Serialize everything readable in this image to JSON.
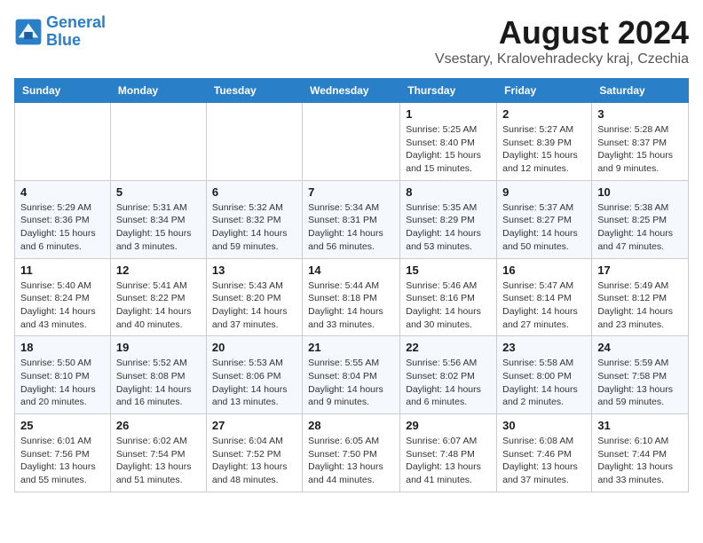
{
  "header": {
    "logo_line1": "General",
    "logo_line2": "Blue",
    "month_title": "August 2024",
    "location": "Vsestary, Kralovehradecky kraj, Czechia"
  },
  "days_of_week": [
    "Sunday",
    "Monday",
    "Tuesday",
    "Wednesday",
    "Thursday",
    "Friday",
    "Saturday"
  ],
  "weeks": [
    [
      {
        "day": "",
        "info": ""
      },
      {
        "day": "",
        "info": ""
      },
      {
        "day": "",
        "info": ""
      },
      {
        "day": "",
        "info": ""
      },
      {
        "day": "1",
        "info": "Sunrise: 5:25 AM\nSunset: 8:40 PM\nDaylight: 15 hours\nand 15 minutes."
      },
      {
        "day": "2",
        "info": "Sunrise: 5:27 AM\nSunset: 8:39 PM\nDaylight: 15 hours\nand 12 minutes."
      },
      {
        "day": "3",
        "info": "Sunrise: 5:28 AM\nSunset: 8:37 PM\nDaylight: 15 hours\nand 9 minutes."
      }
    ],
    [
      {
        "day": "4",
        "info": "Sunrise: 5:29 AM\nSunset: 8:36 PM\nDaylight: 15 hours\nand 6 minutes."
      },
      {
        "day": "5",
        "info": "Sunrise: 5:31 AM\nSunset: 8:34 PM\nDaylight: 15 hours\nand 3 minutes."
      },
      {
        "day": "6",
        "info": "Sunrise: 5:32 AM\nSunset: 8:32 PM\nDaylight: 14 hours\nand 59 minutes."
      },
      {
        "day": "7",
        "info": "Sunrise: 5:34 AM\nSunset: 8:31 PM\nDaylight: 14 hours\nand 56 minutes."
      },
      {
        "day": "8",
        "info": "Sunrise: 5:35 AM\nSunset: 8:29 PM\nDaylight: 14 hours\nand 53 minutes."
      },
      {
        "day": "9",
        "info": "Sunrise: 5:37 AM\nSunset: 8:27 PM\nDaylight: 14 hours\nand 50 minutes."
      },
      {
        "day": "10",
        "info": "Sunrise: 5:38 AM\nSunset: 8:25 PM\nDaylight: 14 hours\nand 47 minutes."
      }
    ],
    [
      {
        "day": "11",
        "info": "Sunrise: 5:40 AM\nSunset: 8:24 PM\nDaylight: 14 hours\nand 43 minutes."
      },
      {
        "day": "12",
        "info": "Sunrise: 5:41 AM\nSunset: 8:22 PM\nDaylight: 14 hours\nand 40 minutes."
      },
      {
        "day": "13",
        "info": "Sunrise: 5:43 AM\nSunset: 8:20 PM\nDaylight: 14 hours\nand 37 minutes."
      },
      {
        "day": "14",
        "info": "Sunrise: 5:44 AM\nSunset: 8:18 PM\nDaylight: 14 hours\nand 33 minutes."
      },
      {
        "day": "15",
        "info": "Sunrise: 5:46 AM\nSunset: 8:16 PM\nDaylight: 14 hours\nand 30 minutes."
      },
      {
        "day": "16",
        "info": "Sunrise: 5:47 AM\nSunset: 8:14 PM\nDaylight: 14 hours\nand 27 minutes."
      },
      {
        "day": "17",
        "info": "Sunrise: 5:49 AM\nSunset: 8:12 PM\nDaylight: 14 hours\nand 23 minutes."
      }
    ],
    [
      {
        "day": "18",
        "info": "Sunrise: 5:50 AM\nSunset: 8:10 PM\nDaylight: 14 hours\nand 20 minutes."
      },
      {
        "day": "19",
        "info": "Sunrise: 5:52 AM\nSunset: 8:08 PM\nDaylight: 14 hours\nand 16 minutes."
      },
      {
        "day": "20",
        "info": "Sunrise: 5:53 AM\nSunset: 8:06 PM\nDaylight: 14 hours\nand 13 minutes."
      },
      {
        "day": "21",
        "info": "Sunrise: 5:55 AM\nSunset: 8:04 PM\nDaylight: 14 hours\nand 9 minutes."
      },
      {
        "day": "22",
        "info": "Sunrise: 5:56 AM\nSunset: 8:02 PM\nDaylight: 14 hours\nand 6 minutes."
      },
      {
        "day": "23",
        "info": "Sunrise: 5:58 AM\nSunset: 8:00 PM\nDaylight: 14 hours\nand 2 minutes."
      },
      {
        "day": "24",
        "info": "Sunrise: 5:59 AM\nSunset: 7:58 PM\nDaylight: 13 hours\nand 59 minutes."
      }
    ],
    [
      {
        "day": "25",
        "info": "Sunrise: 6:01 AM\nSunset: 7:56 PM\nDaylight: 13 hours\nand 55 minutes."
      },
      {
        "day": "26",
        "info": "Sunrise: 6:02 AM\nSunset: 7:54 PM\nDaylight: 13 hours\nand 51 minutes."
      },
      {
        "day": "27",
        "info": "Sunrise: 6:04 AM\nSunset: 7:52 PM\nDaylight: 13 hours\nand 48 minutes."
      },
      {
        "day": "28",
        "info": "Sunrise: 6:05 AM\nSunset: 7:50 PM\nDaylight: 13 hours\nand 44 minutes."
      },
      {
        "day": "29",
        "info": "Sunrise: 6:07 AM\nSunset: 7:48 PM\nDaylight: 13 hours\nand 41 minutes."
      },
      {
        "day": "30",
        "info": "Sunrise: 6:08 AM\nSunset: 7:46 PM\nDaylight: 13 hours\nand 37 minutes."
      },
      {
        "day": "31",
        "info": "Sunrise: 6:10 AM\nSunset: 7:44 PM\nDaylight: 13 hours\nand 33 minutes."
      }
    ]
  ]
}
